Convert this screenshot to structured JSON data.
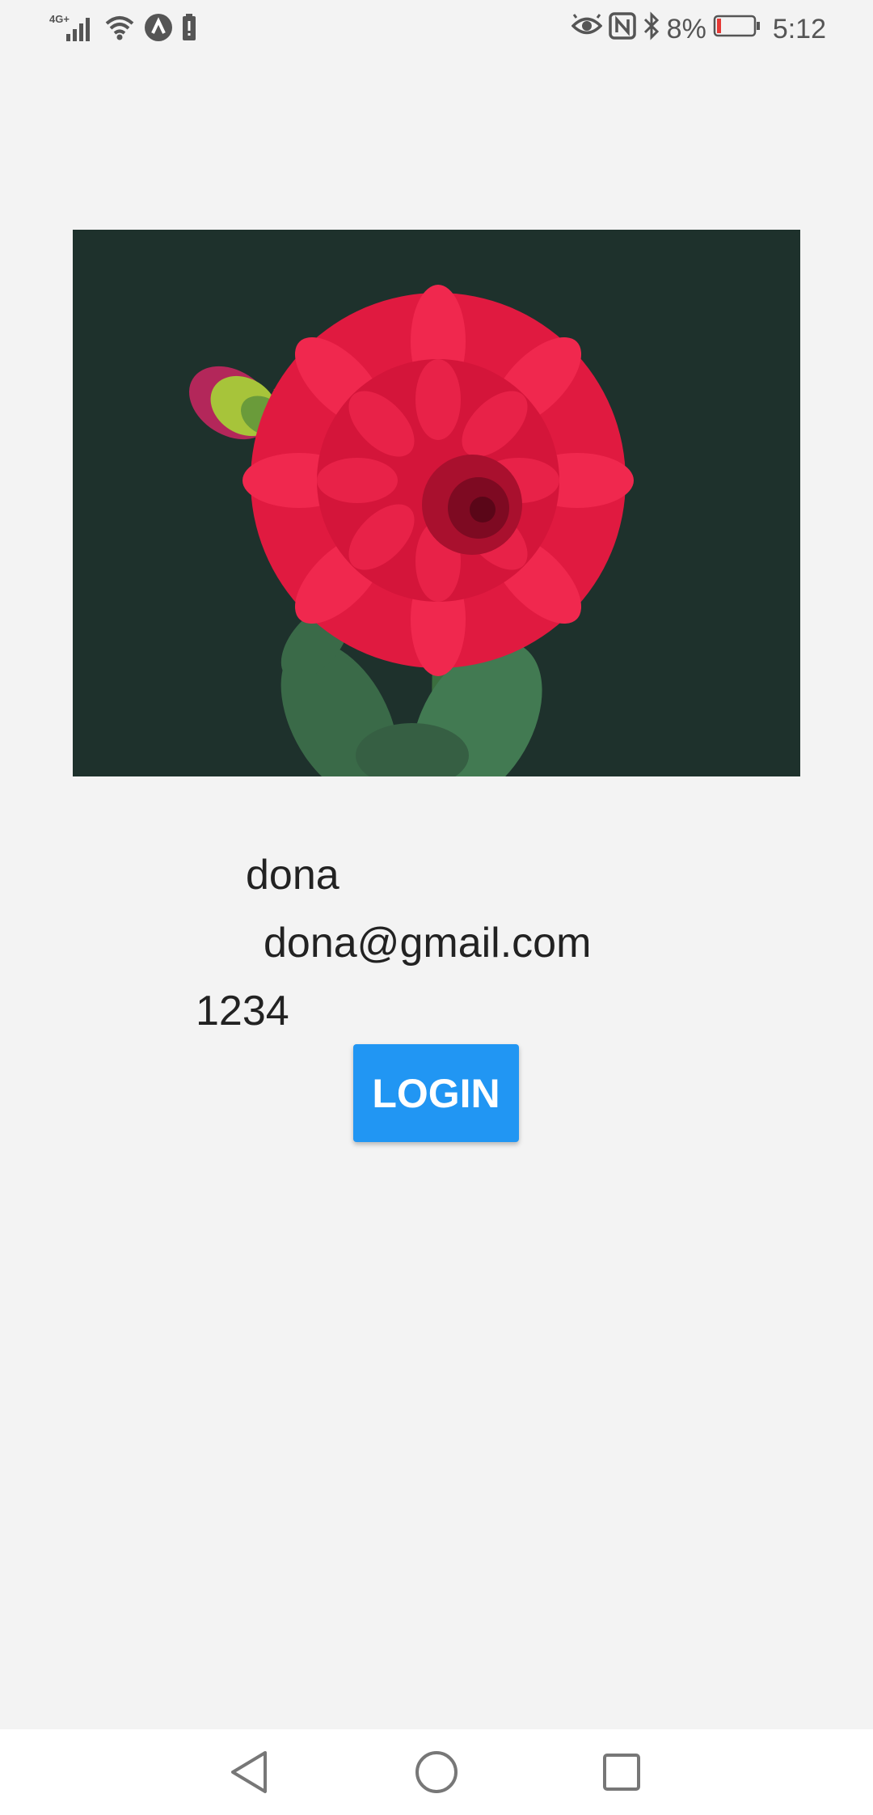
{
  "status_bar": {
    "network_label": "4G+",
    "battery_percent": "8%",
    "time": "5:12",
    "icons": [
      "signal-icon",
      "wifi-icon",
      "app-notification-icon",
      "battery-alert-icon",
      "eye-comfort-icon",
      "nfc-icon",
      "bluetooth-icon",
      "battery-icon"
    ]
  },
  "hero_image": {
    "subject": "red-dahlia-flower",
    "background_color": "#1e312c"
  },
  "form": {
    "username": "dona",
    "email": "dona@gmail.com",
    "password": "1234"
  },
  "login_button": {
    "label": "LOGIN",
    "color": "#2196f3"
  },
  "nav_bar": {
    "icons": [
      "back-icon",
      "home-icon",
      "recents-icon"
    ]
  }
}
